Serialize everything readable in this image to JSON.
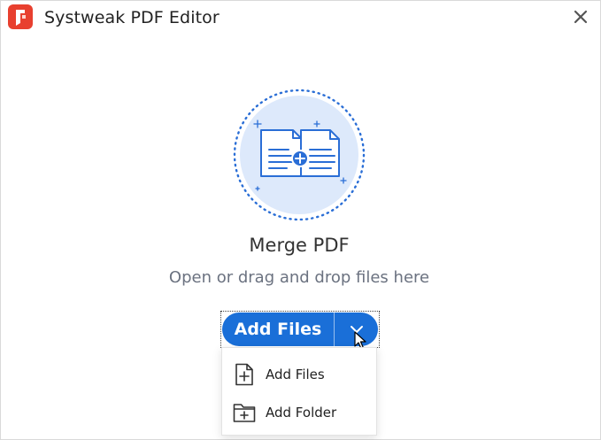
{
  "window": {
    "title": "Systweak PDF Editor",
    "logo_icon": "systweak-pdf-logo-icon",
    "close_icon": "close-icon"
  },
  "main": {
    "illustration_icon": "merge-documents-icon",
    "heading": "Merge PDF",
    "subheading": "Open or drag and drop files here"
  },
  "split_button": {
    "label": "Add Files",
    "toggle_icon": "chevron-down-icon",
    "color": "#1a6fd8"
  },
  "menu": {
    "items": [
      {
        "label": "Add Files",
        "icon": "add-file-icon"
      },
      {
        "label": "Add Folder",
        "icon": "add-folder-icon"
      }
    ]
  },
  "colors": {
    "accent": "#1a6fd8",
    "illustration_bg": "#dde9fb",
    "logo": "#e8402f"
  }
}
